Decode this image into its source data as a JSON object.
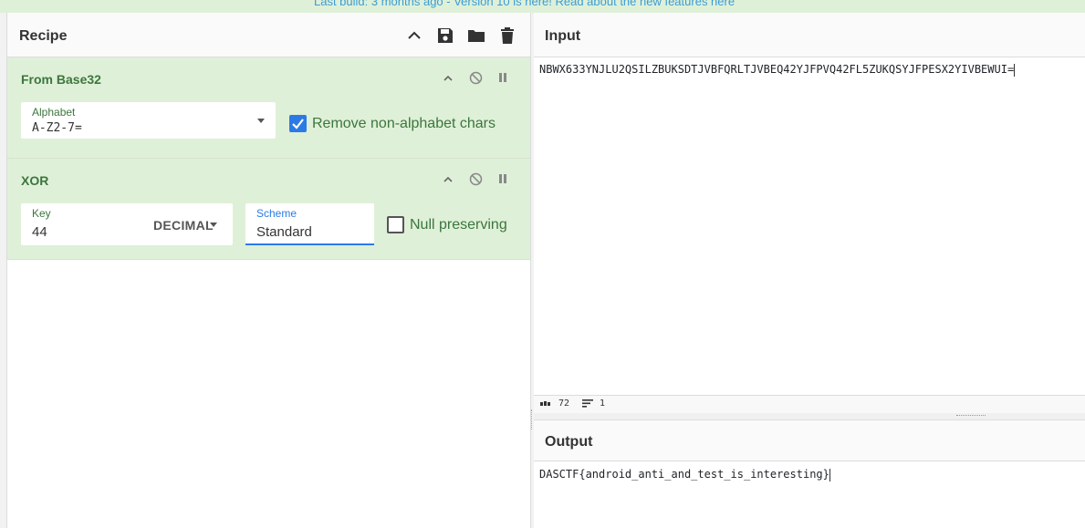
{
  "banner": {
    "text": "Last build: 3 months ago - Version 10 is here! Read about the new features here"
  },
  "recipe": {
    "title": "Recipe",
    "icons": [
      "chevron-up-icon",
      "save-icon",
      "folder-icon",
      "trash-icon"
    ],
    "operations": [
      {
        "name": "From Base32",
        "alphabet_label": "Alphabet",
        "alphabet_value": "A-Z2-7=",
        "remove_label": "Remove non-alphabet chars",
        "remove_checked": true
      },
      {
        "name": "XOR",
        "key_label": "Key",
        "key_value": "44",
        "key_format": "DECIMAL",
        "scheme_label": "Scheme",
        "scheme_value": "Standard",
        "null_label": "Null preserving",
        "null_checked": false
      }
    ]
  },
  "input": {
    "title": "Input",
    "text": "NBWX633YNJLU2QSILZBUKSDTJVBFQRLTJVBEQ42YJFPVQ42FL5ZUKQSYJFPESX2YIVBEWUI=",
    "status": {
      "length": "72",
      "lines": "1"
    }
  },
  "output": {
    "title": "Output",
    "text": "DASCTF{android_anti_and_test_is_interesting}"
  },
  "colors": {
    "op_bg": "#dff0d8",
    "op_text": "#3c763d",
    "accent": "#2c7be5"
  }
}
